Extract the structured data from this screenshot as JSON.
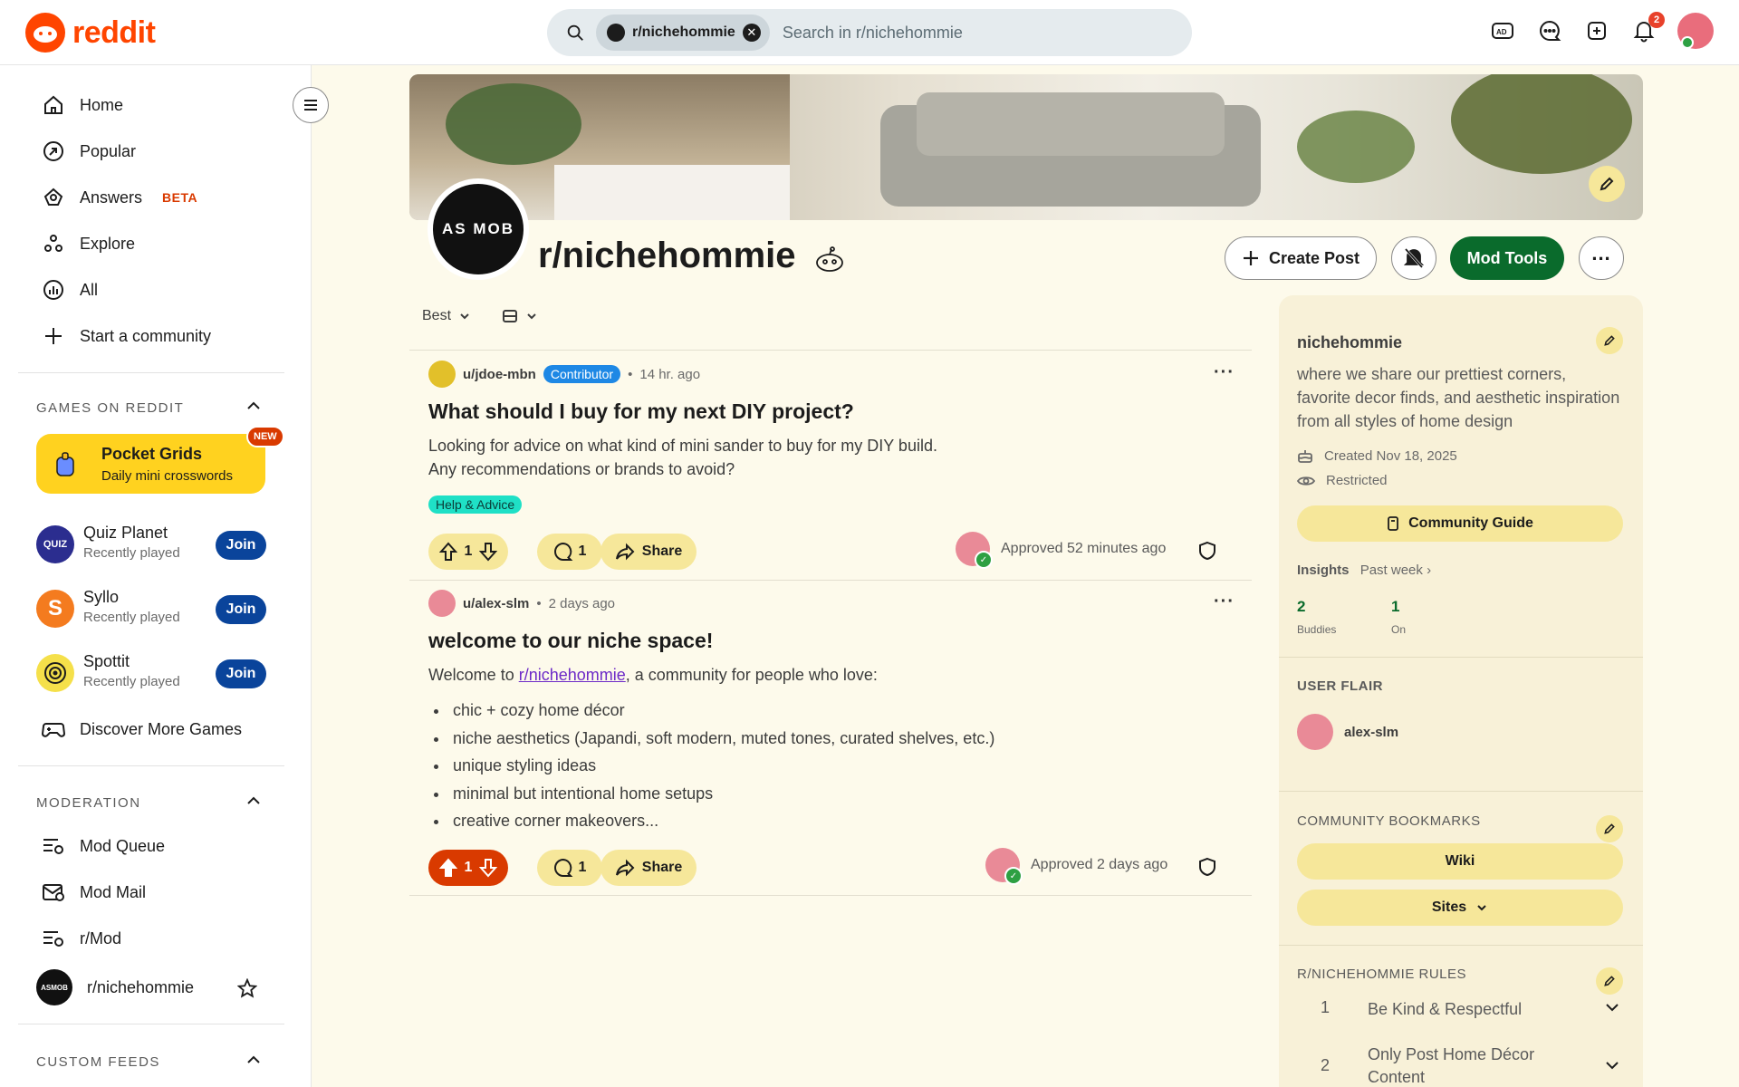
{
  "header": {
    "logo_text": "reddit",
    "search_chip": "r/nichehommie",
    "search_placeholder": "Search in r/nichehommie",
    "notification_count": "2"
  },
  "sidebar": {
    "nav": [
      {
        "label": "Home",
        "icon": "home-icon"
      },
      {
        "label": "Popular",
        "icon": "popular-icon"
      },
      {
        "label": "Answers",
        "icon": "answers-icon",
        "badge": "BETA"
      },
      {
        "label": "Explore",
        "icon": "explore-icon"
      },
      {
        "label": "All",
        "icon": "all-icon"
      },
      {
        "label": "Start a community",
        "icon": "plus-icon"
      }
    ],
    "games_title": "GAMES ON REDDIT",
    "pocket": {
      "title": "Pocket Grids",
      "subtitle": "Daily mini crosswords",
      "badge": "NEW"
    },
    "games": [
      {
        "name": "Quiz Planet",
        "sub": "Recently played",
        "join": "Join",
        "icon_label": "QUIZ",
        "color": "#2b2d8f"
      },
      {
        "name": "Syllo",
        "sub": "Recently played",
        "join": "Join",
        "icon_label": "S",
        "color": "#f47b1f"
      },
      {
        "name": "Spottit",
        "sub": "Recently played",
        "join": "Join",
        "icon_label": "",
        "color": "#f5e04a"
      }
    ],
    "discover_games": "Discover More Games",
    "moderation_title": "MODERATION",
    "moderation": [
      {
        "label": "Mod Queue",
        "icon": "mod-queue-icon"
      },
      {
        "label": "Mod Mail",
        "icon": "mod-mail-icon"
      },
      {
        "label": "r/Mod",
        "icon": "r-mod-icon"
      },
      {
        "label": "r/nichehommie",
        "icon": "community-avatar"
      }
    ],
    "custom_feeds_title": "CUSTOM FEEDS"
  },
  "community": {
    "name": "r/nichehommie",
    "avatar_text": "AS MOB",
    "create_post": "Create Post",
    "mod_tools": "Mod Tools"
  },
  "feed": {
    "sort": "Best",
    "posts": [
      {
        "author": "u/jdoe-mbn",
        "flair": "Contributor",
        "time": "14 hr. ago",
        "title": "What should I buy for my next DIY project?",
        "body_line1": "Looking for advice on what kind of mini sander to buy for my DIY build.",
        "body_line2": "Any recommendations or brands to avoid?",
        "post_flair": "Help & Advice",
        "votes": "1",
        "comments": "1",
        "share": "Share",
        "approved": "Approved 52 minutes ago"
      },
      {
        "author": "u/alex-slm",
        "time": "2 days ago",
        "title": "welcome to our niche space!",
        "body_prefix": "Welcome to ",
        "body_link": "r/nichehommie",
        "body_suffix": ", a community for people who love:",
        "bullets": [
          "chic + cozy home décor",
          "niche aesthetics (Japandi, soft modern, muted tones, curated shelves, etc.)",
          "unique styling ideas",
          "minimal but intentional home setups",
          "creative corner makeovers..."
        ],
        "votes": "1",
        "comments": "1",
        "share": "Share",
        "approved": "Approved 2 days ago"
      }
    ]
  },
  "about": {
    "name": "nichehommie",
    "description": "where we share our prettiest corners, favorite decor finds, and aesthetic inspiration from all styles of home design",
    "created": "Created Nov 18, 2025",
    "visibility": "Restricted",
    "community_guide": "Community Guide",
    "insights_label": "Insights",
    "insights_period": "Past week",
    "stats": [
      {
        "value": "2",
        "label": "Buddies"
      },
      {
        "value": "1",
        "label": "On"
      }
    ],
    "user_flair_title": "USER FLAIR",
    "user_flair_name": "alex-slm",
    "bookmarks_title": "COMMUNITY BOOKMARKS",
    "bookmark_wiki": "Wiki",
    "bookmark_sites": "Sites",
    "rules_title": "R/NICHEHOMMIE RULES",
    "rules": [
      {
        "num": "1",
        "text": "Be Kind & Respectful"
      },
      {
        "num": "2",
        "text": "Only Post Home Décor Content"
      }
    ]
  },
  "colors": {
    "brand": "#ff4500",
    "mod_tools_green": "#0a6b2c",
    "pill_yellow": "#f6e79a",
    "upvote_active": "#d93a00",
    "join_blue": "#0a449b"
  }
}
